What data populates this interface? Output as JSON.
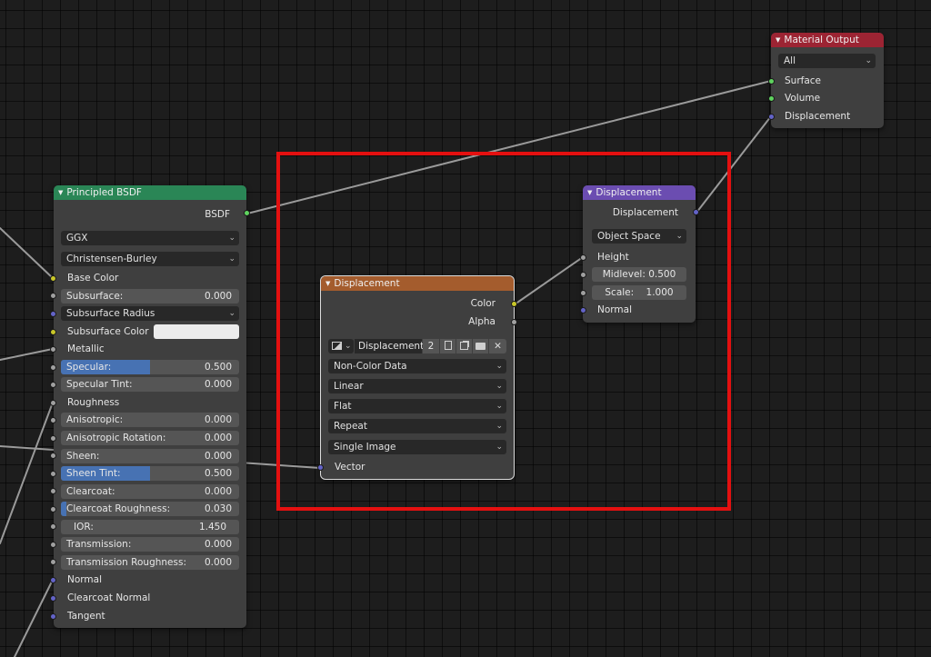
{
  "colors": {
    "header_shader": "#2a8656",
    "header_texture": "#a45c2d",
    "header_vector": "#6b4db1",
    "header_output": "#9c2433",
    "socket_shader": "#5fd35f",
    "socket_color": "#c9c729",
    "socket_float": "#a0a0a0",
    "socket_vector": "#6363c7",
    "highlight": "#e41010",
    "slider_fill": "#4772b3"
  },
  "principled": {
    "title": "Principled BSDF",
    "output_bsdf": "BSDF",
    "distribution": "GGX",
    "subsurface_method": "Christensen-Burley",
    "base_color": "Base Color",
    "subsurface": {
      "label": "Subsurface:",
      "value": "0.000",
      "fill": 0
    },
    "subsurface_radius": "Subsurface Radius",
    "subsurface_color": "Subsurface Color",
    "metallic": "Metallic",
    "specular": {
      "label": "Specular:",
      "value": "0.500",
      "fill": 0.5
    },
    "specular_tint": {
      "label": "Specular Tint:",
      "value": "0.000",
      "fill": 0
    },
    "roughness": "Roughness",
    "anisotropic": {
      "label": "Anisotropic:",
      "value": "0.000",
      "fill": 0
    },
    "anisotropic_rotation": {
      "label": "Anisotropic Rotation:",
      "value": "0.000",
      "fill": 0
    },
    "sheen": {
      "label": "Sheen:",
      "value": "0.000",
      "fill": 0
    },
    "sheen_tint": {
      "label": "Sheen Tint:",
      "value": "0.500",
      "fill": 0.5
    },
    "clearcoat": {
      "label": "Clearcoat:",
      "value": "0.000",
      "fill": 0
    },
    "clearcoat_roughness": {
      "label": "Clearcoat Roughness:",
      "value": "0.030",
      "fill": 0.03
    },
    "ior": {
      "label": "IOR:",
      "value": "1.450",
      "fill": 0
    },
    "transmission": {
      "label": "Transmission:",
      "value": "0.000",
      "fill": 0
    },
    "transmission_roughness": {
      "label": "Transmission Roughness:",
      "value": "0.000",
      "fill": 0
    },
    "normal": "Normal",
    "clearcoat_normal": "Clearcoat Normal",
    "tangent": "Tangent"
  },
  "image_texture": {
    "title": "Displacement",
    "output_color": "Color",
    "output_alpha": "Alpha",
    "image_name": "Displacement",
    "user_count": "2",
    "color_space": "Non-Color Data",
    "interpolation": "Linear",
    "projection": "Flat",
    "extension": "Repeat",
    "source": "Single Image",
    "input_vector": "Vector"
  },
  "displacement": {
    "title": "Displacement",
    "output_displacement": "Displacement",
    "space": "Object Space",
    "height": "Height",
    "midlevel": {
      "label": "Midlevel:",
      "value": "0.500"
    },
    "scale": {
      "label": "Scale:",
      "value": "1.000"
    },
    "normal": "Normal"
  },
  "material_output": {
    "title": "Material Output",
    "target": "All",
    "surface": "Surface",
    "volume": "Volume",
    "displacement": "Displacement"
  }
}
